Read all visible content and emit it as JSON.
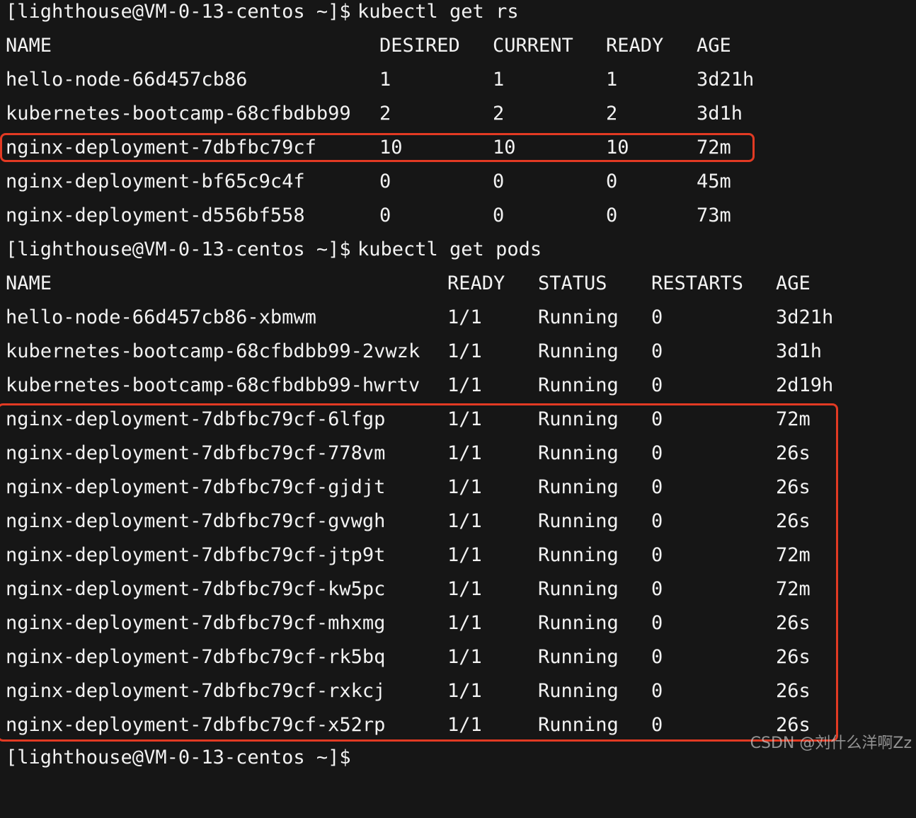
{
  "terminal": {
    "prompt": "[lighthouse@VM-0-13-centos ~]$",
    "cmd_rs": "kubectl get rs",
    "cmd_pods": "kubectl get pods",
    "prompt_last": "[lighthouse@VM-0-13-centos ~]$"
  },
  "rs_table": {
    "headers": [
      "NAME",
      "DESIRED",
      "CURRENT",
      "READY",
      "AGE"
    ],
    "rows": [
      [
        "hello-node-66d457cb86",
        "1",
        "1",
        "1",
        "3d21h"
      ],
      [
        "kubernetes-bootcamp-68cfbdbb99",
        "2",
        "2",
        "2",
        "3d1h"
      ],
      [
        "nginx-deployment-7dbfbc79cf",
        "10",
        "10",
        "10",
        "72m"
      ],
      [
        "nginx-deployment-bf65c9c4f",
        "0",
        "0",
        "0",
        "45m"
      ],
      [
        "nginx-deployment-d556bf558",
        "0",
        "0",
        "0",
        "73m"
      ]
    ]
  },
  "pods_table": {
    "headers": [
      "NAME",
      "READY",
      "STATUS",
      "RESTARTS",
      "AGE"
    ],
    "rows": [
      [
        "hello-node-66d457cb86-xbmwm",
        "1/1",
        "Running",
        "0",
        "3d21h"
      ],
      [
        "kubernetes-bootcamp-68cfbdbb99-2vwzk",
        "1/1",
        "Running",
        "0",
        "3d1h"
      ],
      [
        "kubernetes-bootcamp-68cfbdbb99-hwrtv",
        "1/1",
        "Running",
        "0",
        "2d19h"
      ],
      [
        "nginx-deployment-7dbfbc79cf-6lfgp",
        "1/1",
        "Running",
        "0",
        "72m"
      ],
      [
        "nginx-deployment-7dbfbc79cf-778vm",
        "1/1",
        "Running",
        "0",
        "26s"
      ],
      [
        "nginx-deployment-7dbfbc79cf-gjdjt",
        "1/1",
        "Running",
        "0",
        "26s"
      ],
      [
        "nginx-deployment-7dbfbc79cf-gvwgh",
        "1/1",
        "Running",
        "0",
        "26s"
      ],
      [
        "nginx-deployment-7dbfbc79cf-jtp9t",
        "1/1",
        "Running",
        "0",
        "72m"
      ],
      [
        "nginx-deployment-7dbfbc79cf-kw5pc",
        "1/1",
        "Running",
        "0",
        "72m"
      ],
      [
        "nginx-deployment-7dbfbc79cf-mhxmg",
        "1/1",
        "Running",
        "0",
        "26s"
      ],
      [
        "nginx-deployment-7dbfbc79cf-rk5bq",
        "1/1",
        "Running",
        "0",
        "26s"
      ],
      [
        "nginx-deployment-7dbfbc79cf-rxkcj",
        "1/1",
        "Running",
        "0",
        "26s"
      ],
      [
        "nginx-deployment-7dbfbc79cf-x52rp",
        "1/1",
        "Running",
        "0",
        "26s"
      ]
    ]
  },
  "watermark": "CSDN @刘什么洋啊Zz",
  "colors": {
    "background": "#161616",
    "text": "#f2f2f2",
    "highlight": "#e23a23"
  }
}
